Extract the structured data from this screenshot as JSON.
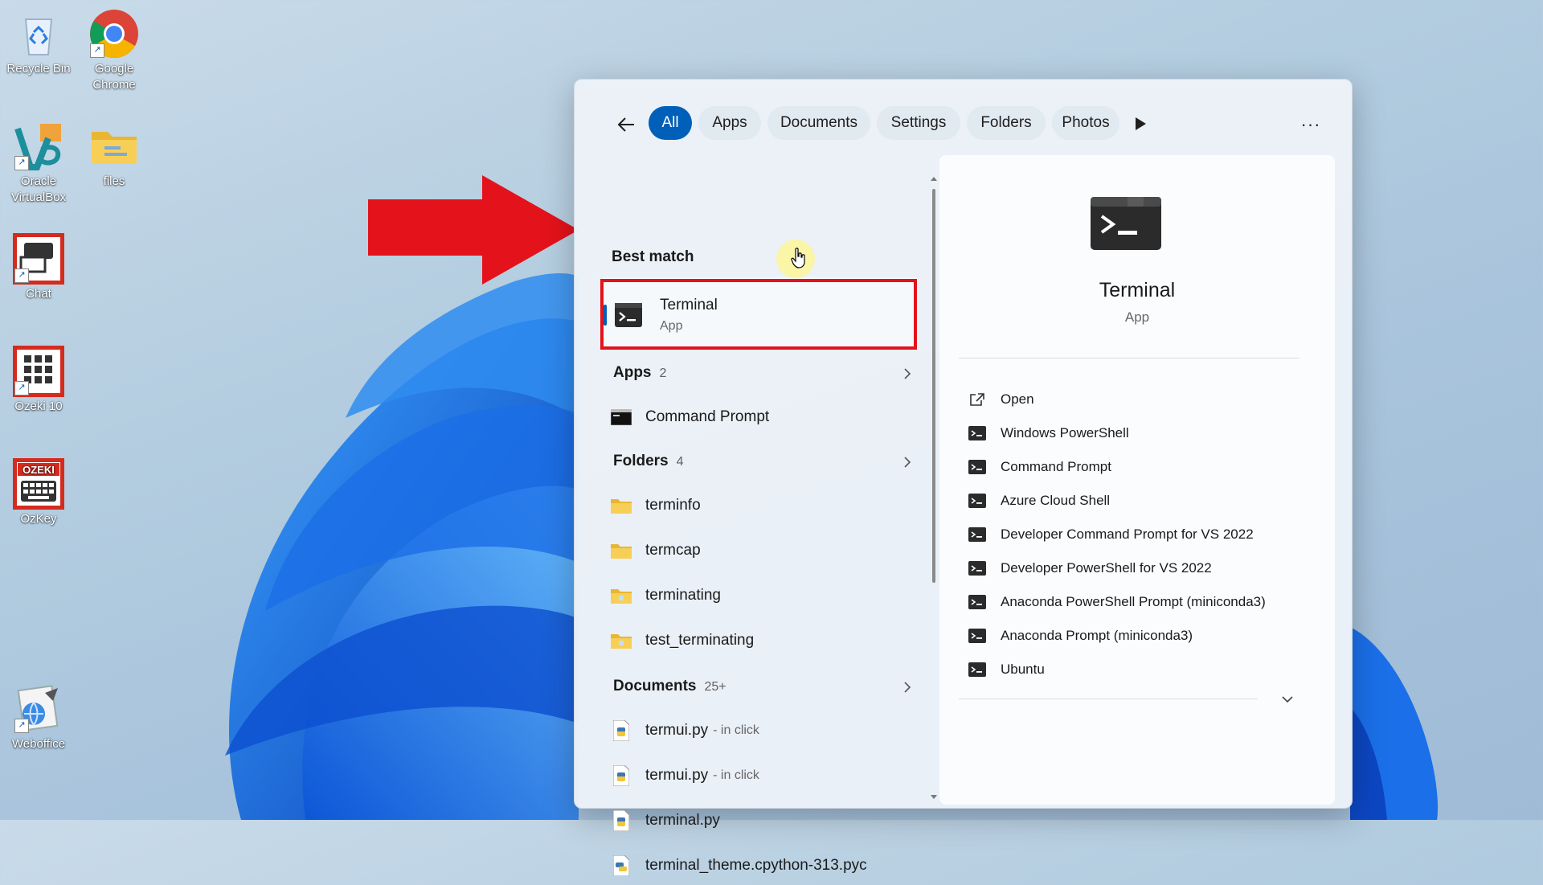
{
  "desktop": {
    "icons": [
      {
        "label": "Recycle Bin",
        "icon": "recycle-bin-icon"
      },
      {
        "label": "Google Chrome",
        "icon": "chrome-icon"
      },
      {
        "label": "Oracle VirtualBox",
        "icon": "virtualbox-icon"
      },
      {
        "label": "files",
        "icon": "folder-icon"
      },
      {
        "label": "Chat",
        "icon": "chat-icon"
      },
      {
        "label": "Ozeki 10",
        "icon": "ozeki-icon"
      },
      {
        "label": "OzKey",
        "icon": "ozkey-icon"
      },
      {
        "label": "Weboffice",
        "icon": "weboffice-icon"
      }
    ],
    "ozkey_logo_text": "OZEKI"
  },
  "search": {
    "filters": [
      {
        "label": "All",
        "active": true
      },
      {
        "label": "Apps",
        "active": false
      },
      {
        "label": "Documents",
        "active": false
      },
      {
        "label": "Settings",
        "active": false
      },
      {
        "label": "Folders",
        "active": false
      },
      {
        "label": "Photos",
        "active": false
      }
    ],
    "more_label": "···",
    "best_match": {
      "heading": "Best match",
      "name": "Terminal",
      "type": "App",
      "icon": "terminal-icon"
    },
    "apps": {
      "heading": "Apps",
      "count": "2",
      "items": [
        {
          "name": "Command Prompt",
          "icon": "cmd-icon"
        }
      ]
    },
    "folders": {
      "heading": "Folders",
      "count": "4",
      "items": [
        {
          "name": "terminfo"
        },
        {
          "name": "termcap"
        },
        {
          "name": "terminating"
        },
        {
          "name": "test_terminating"
        }
      ]
    },
    "documents": {
      "heading": "Documents",
      "count": "25+",
      "items": [
        {
          "name": "termui.py",
          "location": "- in click",
          "icon": "python-file-icon"
        },
        {
          "name": "termui.py",
          "location": "- in click",
          "icon": "python-file-icon"
        },
        {
          "name": "terminal.py",
          "location": "",
          "icon": "python-file-icon"
        },
        {
          "name": "terminal_theme.cpython-313.pyc",
          "location": "",
          "icon": "python-compiled-icon"
        }
      ]
    },
    "detail": {
      "title": "Terminal",
      "subtitle": "App",
      "actions": [
        {
          "label": "Open",
          "icon": "open-external-icon"
        },
        {
          "label": "Windows PowerShell",
          "icon": "terminal-small-icon"
        },
        {
          "label": "Command Prompt",
          "icon": "terminal-small-icon"
        },
        {
          "label": "Azure Cloud Shell",
          "icon": "terminal-small-icon"
        },
        {
          "label": "Developer Command Prompt for VS 2022",
          "icon": "terminal-small-icon"
        },
        {
          "label": "Developer PowerShell for VS 2022",
          "icon": "terminal-small-icon"
        },
        {
          "label": "Anaconda PowerShell Prompt (miniconda3)",
          "icon": "terminal-small-icon"
        },
        {
          "label": "Anaconda Prompt (miniconda3)",
          "icon": "terminal-small-icon"
        },
        {
          "label": "Ubuntu",
          "icon": "terminal-small-icon"
        }
      ]
    }
  },
  "colors": {
    "accent": "#005fb8",
    "annotation_red": "#e4121b",
    "folder_yellow": "#f4c542"
  }
}
